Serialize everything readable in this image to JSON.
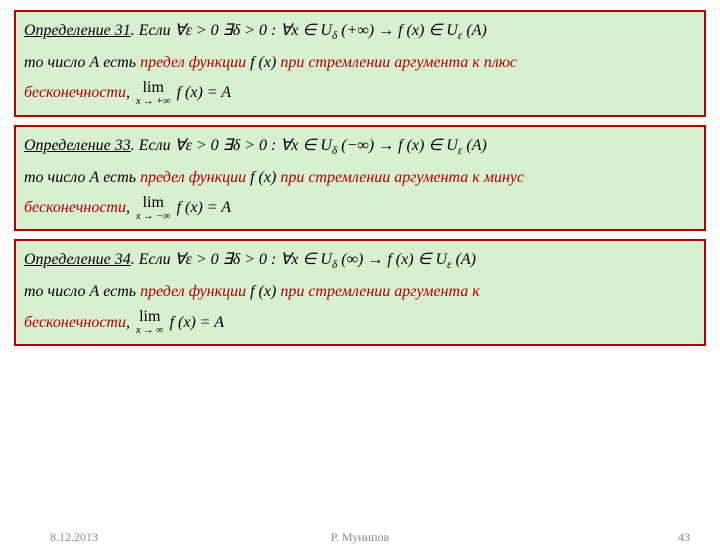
{
  "defs": [
    {
      "title": "Определение 31",
      "if": ". Если ",
      "cond": "∀ε > 0 ∃δ > 0 :   ∀x ∈ U",
      "condSubA": "δ",
      "condArg": " (+∞)   →   f (x) ∈ U",
      "condSubB": "ε",
      "condEnd": " (A)",
      "line2a": "то число ",
      "line2A": "A",
      "line2b": "  есть ",
      "term": "предел функции ",
      "fx": "f (x)",
      "tail": " при стремлении аргумента к плюс",
      "line3": "бесконечности",
      "comma": ", ",
      "limSub": "x → +∞",
      "limExpr": "f (x) = A"
    },
    {
      "title": "Определение 33",
      "if": ". Если ",
      "cond": "∀ε > 0 ∃δ > 0 :   ∀x ∈ U",
      "condSubA": "δ",
      "condArg": " (−∞)   →   f (x) ∈ U",
      "condSubB": "ε",
      "condEnd": " (A)",
      "line2a": "то число ",
      "line2A": "A",
      "line2b": "  есть ",
      "term": "предел функции ",
      "fx": "f (x)",
      "tail": " при стремлении аргумента к минус",
      "line3": "бесконечности",
      "comma": ", ",
      "limSub": "x → −∞",
      "limExpr": "f (x) = A"
    },
    {
      "title": "Определение 34",
      "if": ". Если ",
      "cond": "∀ε > 0 ∃δ > 0 :   ∀x ∈ U",
      "condSubA": "δ",
      "condArg": " (∞)   →   f (x) ∈ U",
      "condSubB": "ε",
      "condEnd": " (A)",
      "line2a": "то число ",
      "line2A": "A",
      "line2b": "  есть ",
      "term": "предел функции ",
      "fx": "f (x)",
      "tail": " при стремлении аргумента к",
      "line3": "бесконечности",
      "comma": ", ",
      "limSub": "x → ∞",
      "limExpr": "f (x) = A"
    }
  ],
  "limWord": "lim",
  "footer": {
    "date": "8.12.2013",
    "author": "Р. Мунипов",
    "page": "43"
  }
}
